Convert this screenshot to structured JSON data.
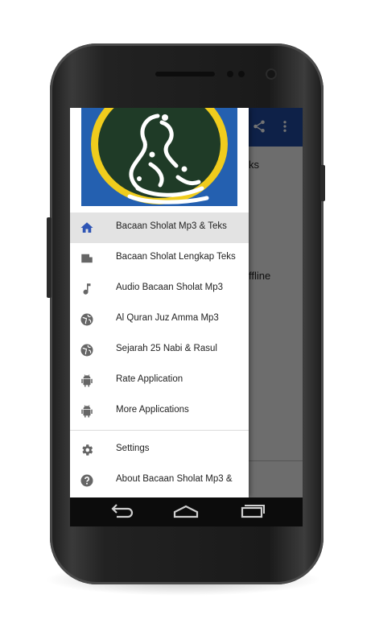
{
  "background_app": {
    "partial_text_1": "ks",
    "partial_text_2": "ffline",
    "appbar_color": "#1f4aa0",
    "appbar_icons": [
      "share-icon",
      "more-vert-icon"
    ]
  },
  "drawer": {
    "header_image": "calligraphy-emblem",
    "items": [
      {
        "label": "Bacaan Sholat Mp3 & Teks",
        "icon": "home-icon",
        "active": true
      },
      {
        "label": "Bacaan Sholat Lengkap Teks",
        "icon": "document-icon"
      },
      {
        "label": "Audio Bacaan Sholat Mp3",
        "icon": "music-note-icon"
      },
      {
        "label": "Al Quran Juz Amma Mp3",
        "icon": "globe-icon"
      },
      {
        "label": "Sejarah 25 Nabi & Rasul",
        "icon": "globe-icon"
      },
      {
        "label": "Rate Application",
        "icon": "android-icon"
      },
      {
        "label": "More Applications",
        "icon": "android-icon"
      }
    ],
    "secondary_items": [
      {
        "label": "Settings",
        "icon": "gear-icon"
      },
      {
        "label": "About Bacaan Sholat Mp3 &",
        "icon": "help-icon"
      }
    ],
    "accent_color": "#2f55b5"
  },
  "navbar": {
    "buttons": [
      "back-icon",
      "home-nav-icon",
      "recent-apps-icon"
    ]
  }
}
